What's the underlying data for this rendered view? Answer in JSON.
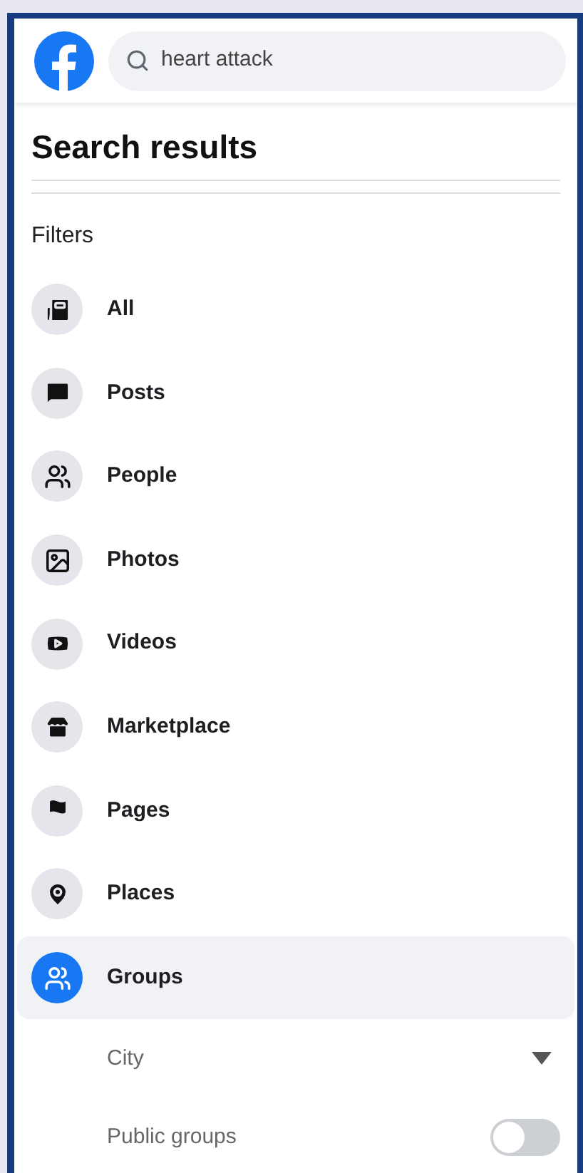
{
  "search": {
    "value": "heart attack"
  },
  "title": "Search results",
  "filters_label": "Filters",
  "filters": [
    {
      "label": "All",
      "selected": false
    },
    {
      "label": "Posts",
      "selected": false
    },
    {
      "label": "People",
      "selected": false
    },
    {
      "label": "Photos",
      "selected": false
    },
    {
      "label": "Videos",
      "selected": false
    },
    {
      "label": "Marketplace",
      "selected": false
    },
    {
      "label": "Pages",
      "selected": false
    },
    {
      "label": "Places",
      "selected": false
    },
    {
      "label": "Groups",
      "selected": true
    }
  ],
  "options": [
    {
      "kind": "dropdown",
      "label": "City"
    },
    {
      "kind": "toggle",
      "label": "Public groups",
      "on": false
    }
  ]
}
